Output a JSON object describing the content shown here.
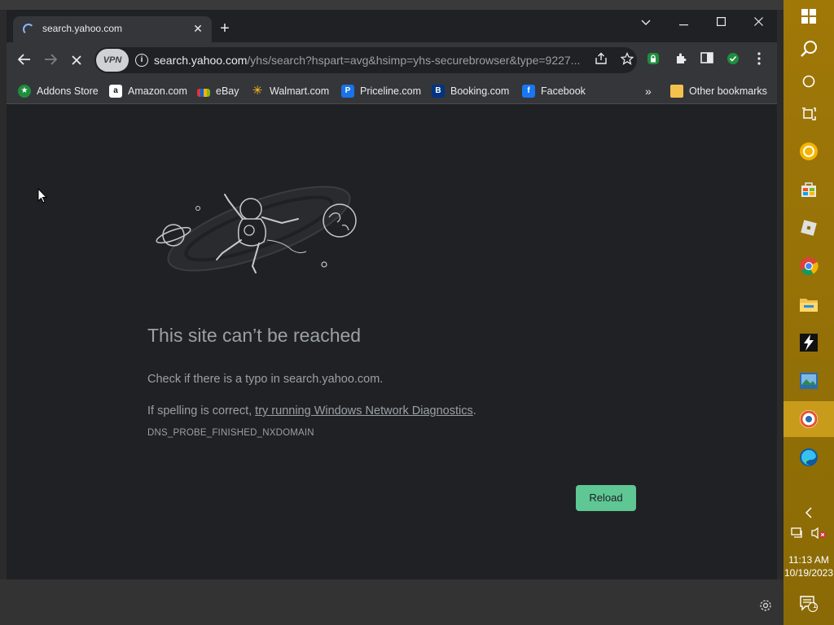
{
  "tab": {
    "title": "search.yahoo.com",
    "close": "✕",
    "new_tab": "+"
  },
  "window_controls": {
    "dropdown": "⌄",
    "minimize": "—",
    "maximize": "☐",
    "close": "✕"
  },
  "toolbar": {
    "back": "←",
    "forward": "→",
    "stop": "✕",
    "vpn_label": "VPN",
    "url_host": "search.yahoo.com",
    "url_path": "/yhs/search?hspart=avg&hsimp=yhs-securebrowser&type=9227..."
  },
  "bookmarks": [
    {
      "label": "Addons Store",
      "icon": "addons-store-icon",
      "color": "#1e8e3e"
    },
    {
      "label": "Amazon.com",
      "icon": "amazon-icon",
      "color": "#ffffff"
    },
    {
      "label": "eBay",
      "icon": "ebay-icon",
      "color": "#e53238"
    },
    {
      "label": "Walmart.com",
      "icon": "walmart-icon",
      "color": "#ffc220"
    },
    {
      "label": "Priceline.com",
      "icon": "priceline-icon",
      "color": "#1a73e8"
    },
    {
      "label": "Booking.com",
      "icon": "booking-icon",
      "color": "#003580"
    },
    {
      "label": "Facebook",
      "icon": "facebook-icon",
      "color": "#1877f2"
    }
  ],
  "bookmarks_overflow": "»",
  "other_bookmarks": "Other bookmarks",
  "error": {
    "title": "This site can’t be reached",
    "line1": "Check if there is a typo in search.yahoo.com.",
    "line2_prefix": "If spelling is correct, ",
    "line2_link": "try running Windows Network Diagnostics",
    "line2_suffix": ".",
    "code": "DNS_PROBE_FINISHED_NXDOMAIN",
    "reload": "Reload"
  },
  "taskbar": {
    "time": "11:13 AM",
    "date": "10/19/2023",
    "notification_count": "1"
  },
  "colors": {
    "accent_button": "#5ec794",
    "taskbar": "#a07808",
    "page_bg": "#202124"
  }
}
